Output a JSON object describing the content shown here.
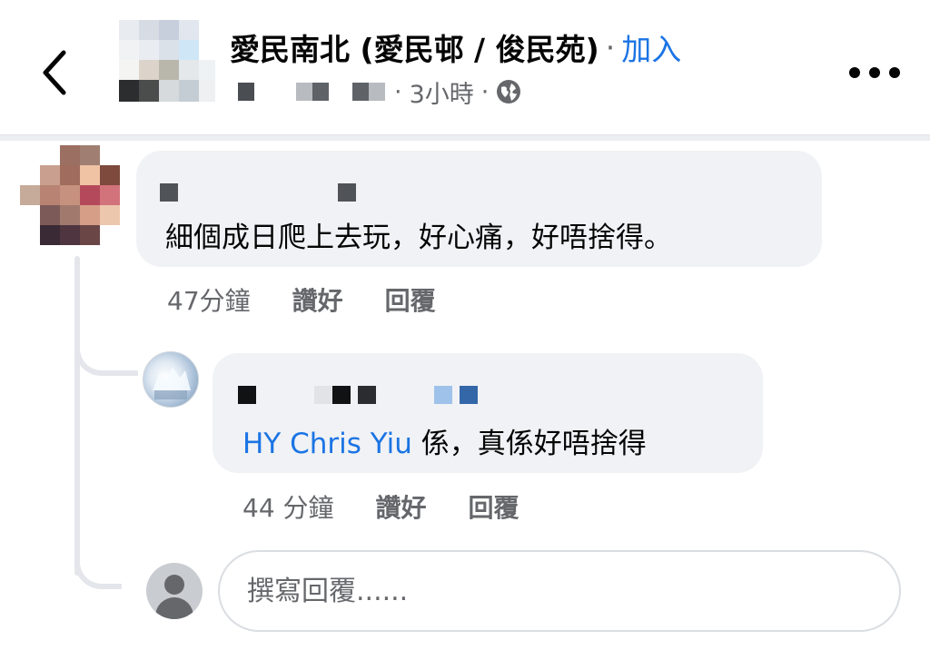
{
  "header": {
    "back_icon": "chevron-left-icon",
    "group_name": "愛民南北 (愛民邨 / 俊民苑)",
    "separator": "·",
    "join_label": "加入",
    "post_time": "3小時",
    "meta_separator": "·",
    "privacy_icon": "globe-icon",
    "more_icon": "more-horizontal-icon"
  },
  "comments": [
    {
      "text": "細個成日爬上去玩，好心痛，好唔捨得。",
      "time": "47分鐘",
      "like_label": "讚好",
      "reply_label": "回覆"
    },
    {
      "mention": "HY Chris Yiu",
      "text": " 係，真係好唔捨得",
      "time": "44 分鐘",
      "like_label": "讚好",
      "reply_label": "回覆"
    }
  ],
  "reply_box": {
    "placeholder": "撰寫回覆......"
  },
  "colors": {
    "accent": "#1b74e4",
    "secondary_text": "#65676b",
    "bubble_bg": "#f0f2f5",
    "thread_line": "#e4e6eb"
  }
}
